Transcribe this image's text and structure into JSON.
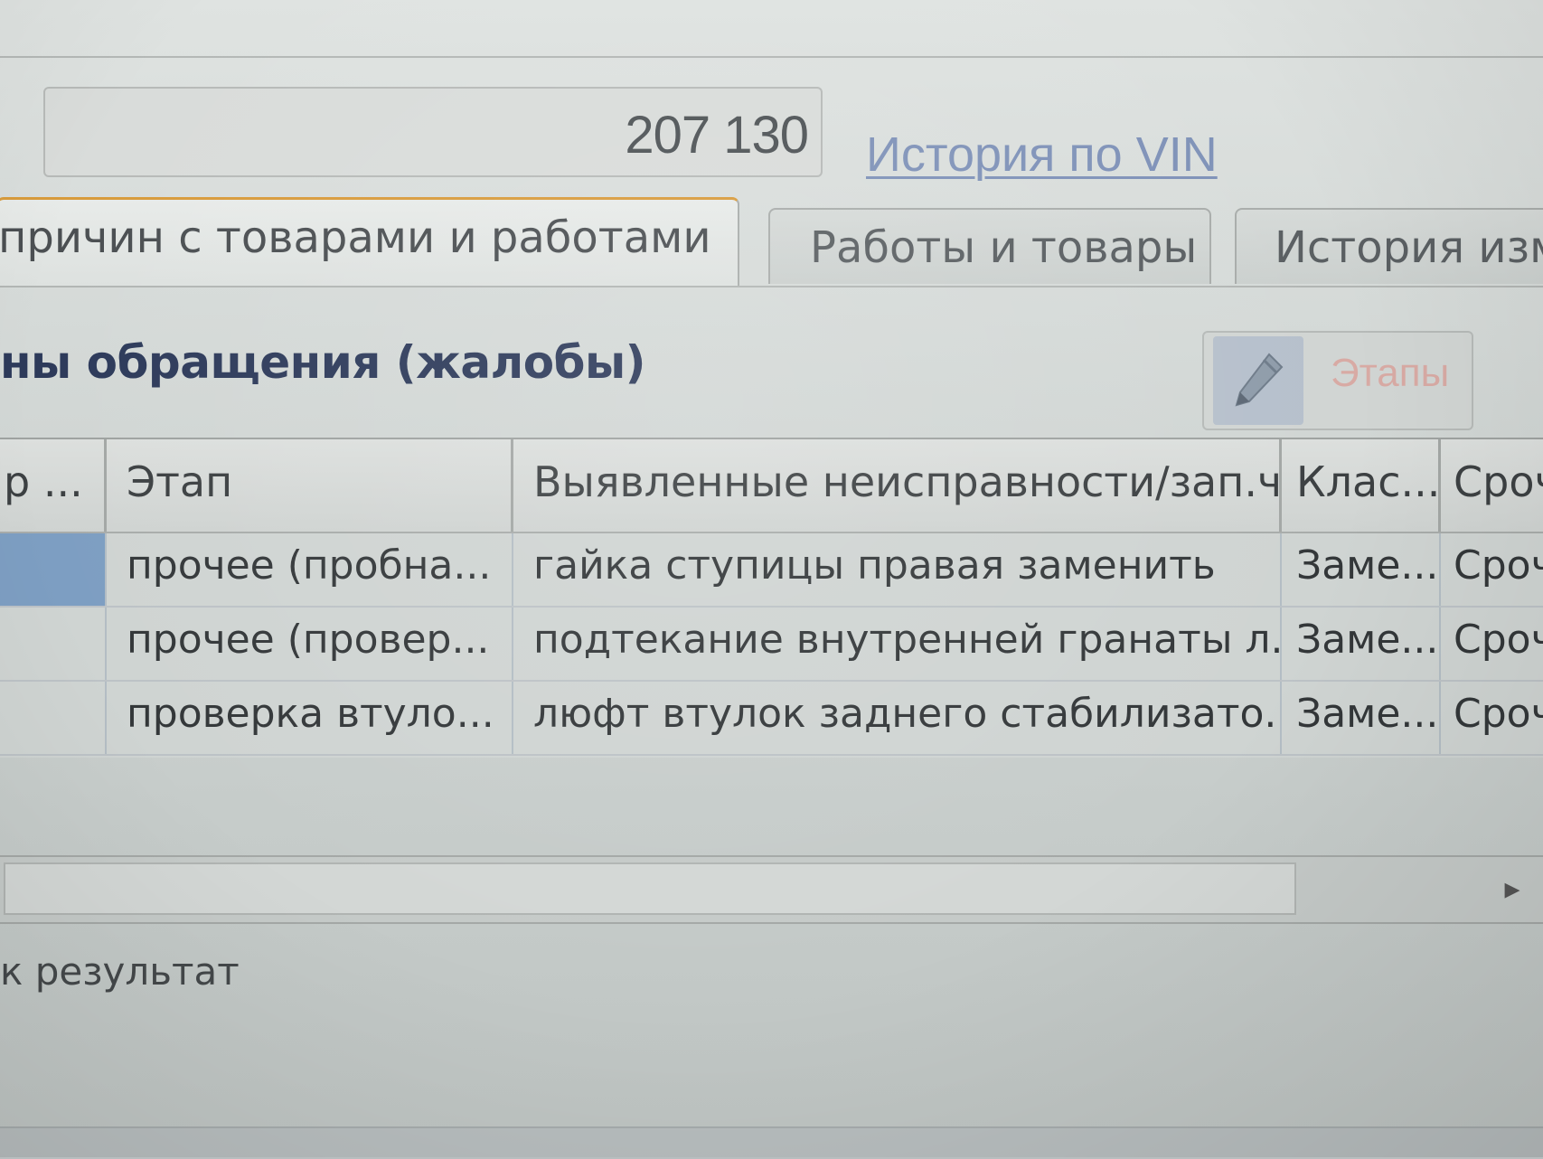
{
  "header": {
    "mileage_value": "207 130",
    "vin_history_link": "История по VIN"
  },
  "tabs": [
    {
      "label": "причин с товарами и работами",
      "active": true
    },
    {
      "label": "Работы и товары",
      "active": false
    },
    {
      "label": "История изме",
      "active": false
    }
  ],
  "section": {
    "title": "ны обращения (жалобы)",
    "stages_button": "Этапы",
    "edit_icon": "pencil-icon"
  },
  "table": {
    "columns": [
      "р ...",
      "Этап",
      "Выявленные неисправности/зап.ч...",
      "Клас...",
      "Сроч"
    ],
    "rows": [
      [
        "",
        "прочее (пробна...",
        "гайка ступицы правая заменить",
        "Заме...",
        "Сроч..."
      ],
      [
        "",
        "прочее (провер...",
        "подтекание внутренней гранаты л...",
        "Заме...",
        "Сроч..."
      ],
      [
        "",
        "проверка втуло...",
        "люфт втулок заднего стабилизато...",
        "Заме...",
        "Сроч..."
      ]
    ],
    "selected_row": 0
  },
  "footer": {
    "result_label": "к результат"
  },
  "colors": {
    "accent_tab": "#d89b3c",
    "selection": "#7d9ec2",
    "link": "#7f92b8",
    "section_title": "#2d3a5a"
  }
}
